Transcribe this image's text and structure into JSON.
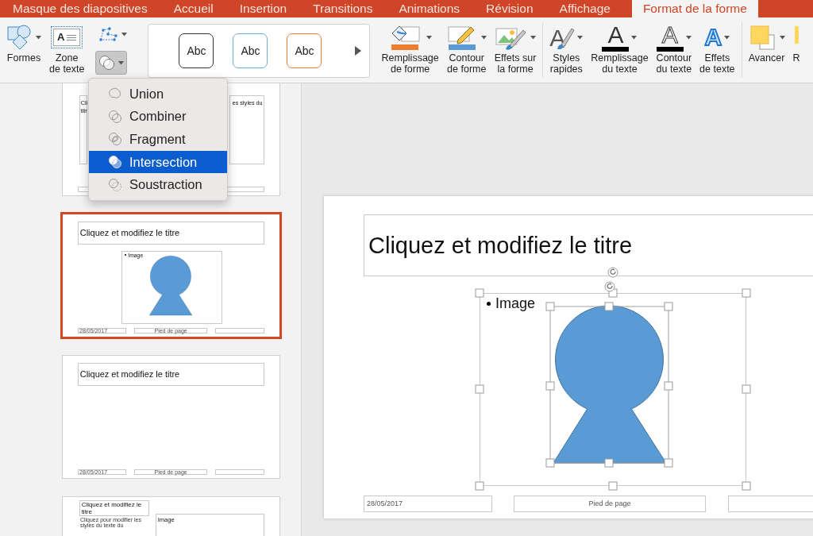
{
  "tabs": [
    {
      "label": "Masque des diapositives",
      "selected": false
    },
    {
      "label": "Accueil",
      "selected": false
    },
    {
      "label": "Insertion",
      "selected": false
    },
    {
      "label": "Transitions",
      "selected": false
    },
    {
      "label": "Animations",
      "selected": false
    },
    {
      "label": "Révision",
      "selected": false
    },
    {
      "label": "Affichage",
      "selected": false
    },
    {
      "label": "Format de la forme",
      "selected": true
    }
  ],
  "ribbon": {
    "groups": [
      {
        "kind": "large",
        "items": [
          {
            "kind": "shapes",
            "lines": [
              "Formes"
            ],
            "dropdown": true
          },
          {
            "kind": "textbox",
            "glyph": "A",
            "lines": [
              "Zone",
              "de texte"
            ],
            "dropdown": false
          }
        ]
      },
      {
        "kind": "stack",
        "items": [
          {
            "kind": "edit_points",
            "dropdown": true,
            "pressed": false
          },
          {
            "kind": "merge",
            "dropdown": true,
            "pressed": true
          }
        ]
      },
      {
        "kind": "gallery",
        "items": [
          {
            "kind": "style",
            "text": "Abc",
            "color": "#333333"
          },
          {
            "kind": "style",
            "text": "Abc",
            "color": "#6fa8dc"
          },
          {
            "kind": "style",
            "text": "Abc",
            "color": "#ed7d31"
          }
        ]
      },
      {
        "kind": "large",
        "items": [
          {
            "kind": "fill",
            "lines": [
              "Remplissage",
              "de forme"
            ],
            "dropdown": true
          },
          {
            "kind": "outline",
            "lines": [
              "Contour",
              "de forme"
            ],
            "dropdown": true
          },
          {
            "kind": "effects",
            "lines": [
              "Effets sur",
              "la forme"
            ],
            "dropdown": true
          }
        ]
      },
      {
        "kind": "large",
        "items": [
          {
            "kind": "quick_styles",
            "glyph": "A",
            "lines": [
              "Styles",
              "rapides"
            ],
            "dropdown": true
          },
          {
            "kind": "text_fill",
            "glyph": "A",
            "lines": [
              "Remplissage",
              "du texte"
            ],
            "dropdown": true
          },
          {
            "kind": "text_outline",
            "glyph": "A",
            "lines": [
              "Contour",
              "du texte"
            ],
            "dropdown": true
          },
          {
            "kind": "text_effects",
            "glyph": "A",
            "lines": [
              "Effets",
              "de texte"
            ],
            "dropdown": true
          }
        ]
      },
      {
        "kind": "large",
        "items": [
          {
            "kind": "forward",
            "lines": [
              "Avancer"
            ],
            "dropdown": true
          },
          {
            "kind": "cut",
            "lines": [
              "R"
            ],
            "dropdown": false
          }
        ]
      }
    ]
  },
  "merge_menu": {
    "items": [
      {
        "kind": "union",
        "label": "Union",
        "selected": false
      },
      {
        "kind": "combine",
        "label": "Combiner",
        "selected": false
      },
      {
        "kind": "fragment",
        "label": "Fragment",
        "selected": false
      },
      {
        "kind": "intersect",
        "label": "Intersection",
        "selected": true
      },
      {
        "kind": "subtract",
        "label": "Soustraction",
        "selected": false
      }
    ]
  },
  "thumbnails": [
    {
      "kind": "partial",
      "selected": false,
      "title_fragments": [
        "Cli",
        "titr"
      ],
      "body_fragment": "es styles du"
    },
    {
      "kind": "title_content",
      "selected": true,
      "title": "Cliquez et modifiez le titre",
      "bullet": "Image",
      "date": "28/05/2017",
      "footer": "Pied de page"
    },
    {
      "kind": "title_only",
      "selected": false,
      "title": "Cliquez et modifiez le titre",
      "date": "28/05/2017",
      "footer": "Pied de page"
    },
    {
      "kind": "two_content",
      "selected": false,
      "title": "Cliquez et modifiez le titre",
      "body": "Cliquez pour modifier les styles du texte du",
      "image_label": "Image"
    }
  ],
  "slide": {
    "kind": "title_content",
    "title": "Cliquez et modifiez le titre",
    "bullet": "Image",
    "date": "28/05/2017",
    "footer": "Pied de page",
    "shape_selected": true
  }
}
